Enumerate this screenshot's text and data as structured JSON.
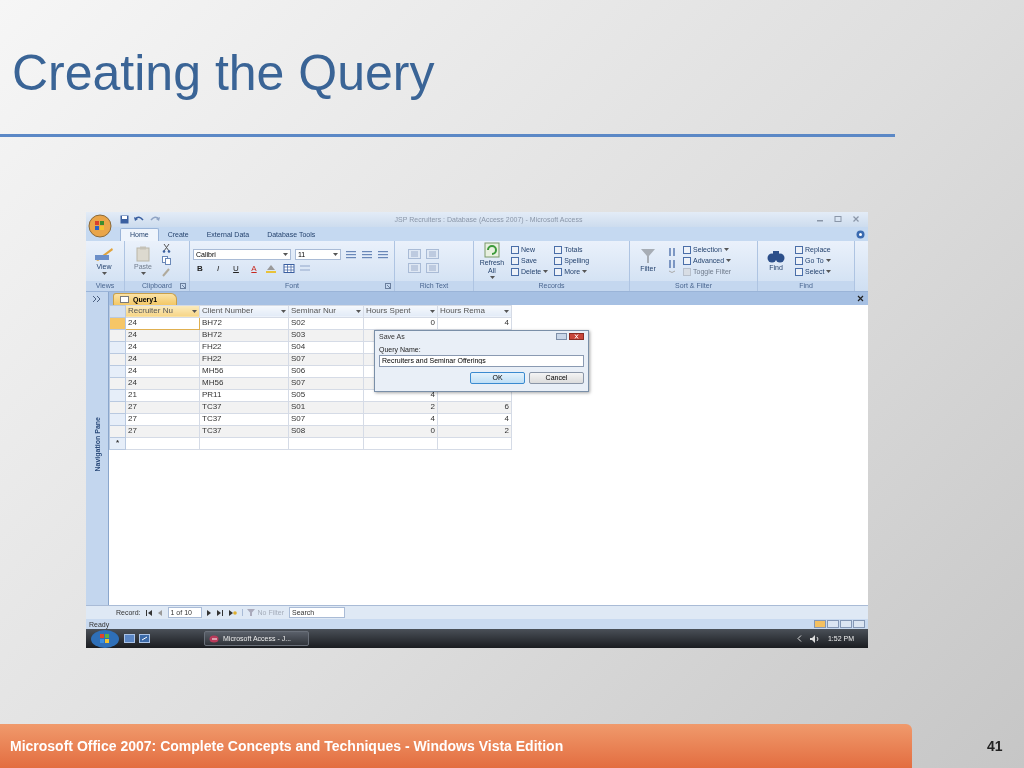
{
  "slide": {
    "title": "Creating the Query",
    "footer": "Microsoft Office 2007: Complete Concepts and Techniques - Windows Vista Edition",
    "page_number": "41"
  },
  "window": {
    "title": "JSP Recruiters : Database (Access 2007) - Microsoft Access"
  },
  "tabs": [
    {
      "label": "Home",
      "selected": true
    },
    {
      "label": "Create",
      "selected": false
    },
    {
      "label": "External Data",
      "selected": false
    },
    {
      "label": "Database Tools",
      "selected": false
    }
  ],
  "ribbon_groups": [
    {
      "kind": "views",
      "label": "Views",
      "launcher": false,
      "large": {
        "label": "View",
        "disabled": false,
        "dropdown": true
      }
    },
    {
      "kind": "clipboard",
      "label": "Clipboard",
      "launcher": true,
      "large": {
        "label": "Paste",
        "disabled": true,
        "dropdown": true
      }
    },
    {
      "kind": "font",
      "label": "Font",
      "launcher": true,
      "font_name": "Calibri",
      "font_size": "11",
      "format": [
        "B",
        "I",
        "U",
        "A"
      ]
    },
    {
      "kind": "rich_text",
      "label": "Rich Text",
      "launcher": false
    },
    {
      "kind": "records",
      "label": "Records",
      "launcher": false,
      "large": {
        "label": "Refresh All",
        "disabled": false,
        "dropdown": true
      },
      "small": [
        {
          "label": "New",
          "disabled": false,
          "dropdown": false
        },
        {
          "label": "Save",
          "disabled": false,
          "dropdown": false
        },
        {
          "label": "Delete",
          "disabled": false,
          "dropdown": true
        },
        {
          "label": "Totals",
          "disabled": false,
          "dropdown": false
        },
        {
          "label": "Spelling",
          "disabled": false,
          "dropdown": false
        },
        {
          "label": "More",
          "disabled": false,
          "dropdown": true
        }
      ]
    },
    {
      "kind": "sort_filter",
      "label": "Sort & Filter",
      "launcher": false,
      "large": {
        "label": "Filter",
        "disabled": false,
        "dropdown": false
      },
      "small": [
        {
          "label": "Selection",
          "disabled": false,
          "dropdown": true
        },
        {
          "label": "Advanced",
          "disabled": false,
          "dropdown": true
        },
        {
          "label": "Toggle Filter",
          "disabled": true,
          "dropdown": false
        }
      ]
    },
    {
      "kind": "find",
      "label": "Find",
      "launcher": false,
      "large": {
        "label": "Find",
        "disabled": false,
        "dropdown": false
      },
      "small": [
        {
          "label": "Replace",
          "disabled": false,
          "dropdown": false
        },
        {
          "label": "Go To",
          "disabled": false,
          "dropdown": true
        },
        {
          "label": "Select",
          "disabled": false,
          "dropdown": true
        }
      ]
    }
  ],
  "document_tab": {
    "label": "Query1"
  },
  "navigation_pane": {
    "label": "Navigation Pane"
  },
  "datasheet": {
    "columns": [
      {
        "label": "Recruiter Nu",
        "numeric": false,
        "selected": true
      },
      {
        "label": "Client Number",
        "numeric": false,
        "selected": false
      },
      {
        "label": "Seminar Nur",
        "numeric": false,
        "selected": false
      },
      {
        "label": "Hours Spent",
        "numeric": true,
        "selected": false
      },
      {
        "label": "Hours Rema",
        "numeric": true,
        "selected": false
      }
    ],
    "rows": [
      {
        "selected": true,
        "cells": [
          "24",
          "BH72",
          "S02",
          "0",
          "4"
        ]
      },
      {
        "selected": false,
        "cells": [
          "24",
          "BH72",
          "S03"
        ]
      },
      {
        "selected": false,
        "cells": [
          "24",
          "FH22",
          "S04"
        ]
      },
      {
        "selected": false,
        "cells": [
          "24",
          "FH22",
          "S07"
        ]
      },
      {
        "selected": false,
        "cells": [
          "24",
          "MH56",
          "S06"
        ]
      },
      {
        "selected": false,
        "cells": [
          "24",
          "MH56",
          "S07"
        ]
      },
      {
        "selected": false,
        "cells": [
          "21",
          "PR11",
          "S05",
          "4"
        ]
      },
      {
        "selected": false,
        "cells": [
          "27",
          "TC37",
          "S01",
          "2",
          "6"
        ]
      },
      {
        "selected": false,
        "cells": [
          "27",
          "TC37",
          "S07",
          "4",
          "4"
        ]
      },
      {
        "selected": false,
        "cells": [
          "27",
          "TC37",
          "S08",
          "0",
          "2"
        ]
      }
    ],
    "new_row_marker": "*"
  },
  "record_navigator": {
    "label": "Record:",
    "position": "1 of 10",
    "filter": {
      "label": "No Filter",
      "active": false
    },
    "search_placeholder": "Search"
  },
  "status_bar": {
    "text": "Ready"
  },
  "taskbar": {
    "task": "Microsoft Access - J...",
    "clock": "1:52 PM"
  },
  "dialog": {
    "title": "Save As",
    "label": "Query Name:",
    "value": "Recruiters and Seminar Offerings",
    "buttons": [
      {
        "label": "OK",
        "default": true
      },
      {
        "label": "Cancel",
        "default": false
      }
    ]
  }
}
